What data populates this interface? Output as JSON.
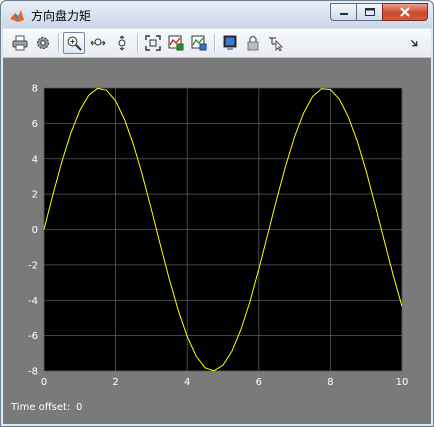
{
  "window": {
    "title": "方向盘力矩"
  },
  "toolbar": {
    "buttons": [
      {
        "name": "print-icon"
      },
      {
        "name": "parameters-gear-icon"
      },
      {
        "name": "zoom-in-icon"
      },
      {
        "name": "zoom-x-icon"
      },
      {
        "name": "zoom-y-icon"
      },
      {
        "name": "autoscale-icon"
      },
      {
        "name": "save-axes-settings-icon"
      },
      {
        "name": "restore-axes-settings-icon"
      },
      {
        "name": "floating-scope-icon"
      },
      {
        "name": "lock-axes-icon"
      },
      {
        "name": "signal-selection-icon"
      },
      {
        "name": "toolbar-overflow-arrow-icon"
      }
    ]
  },
  "footer": {
    "time_offset_label": "Time offset:",
    "time_offset_value": "0"
  },
  "colors": {
    "plot_background": "#000000",
    "scope_background": "#7a7a7a",
    "trace": "#ffff00",
    "grid": "#5a5a5a"
  },
  "chart_data": {
    "type": "line",
    "title": "",
    "xlabel": "",
    "ylabel": "",
    "xlim": [
      0,
      10
    ],
    "ylim": [
      -8,
      8
    ],
    "xticks": [
      0,
      2,
      4,
      6,
      8,
      10
    ],
    "yticks": [
      -8,
      -6,
      -4,
      -2,
      0,
      2,
      4,
      6,
      8
    ],
    "grid": true,
    "series": [
      {
        "color": "#ffff00",
        "x": [
          0,
          0.25,
          0.5,
          0.75,
          1,
          1.25,
          1.5,
          1.75,
          2,
          2.25,
          2.5,
          2.75,
          3,
          3.25,
          3.5,
          3.75,
          4,
          4.25,
          4.5,
          4.75,
          5,
          5.25,
          5.5,
          5.75,
          6,
          6.25,
          6.5,
          6.75,
          7,
          7.25,
          7.5,
          7.75,
          8,
          8.25,
          8.5,
          8.75,
          9,
          9.25,
          9.5,
          9.75,
          10
        ],
        "y": [
          0,
          1.98,
          3.84,
          5.45,
          6.73,
          7.59,
          7.98,
          7.87,
          7.27,
          6.22,
          4.79,
          3.06,
          1.13,
          -0.87,
          -2.81,
          -4.57,
          -6.05,
          -7.16,
          -7.82,
          -7.99,
          -7.67,
          -6.88,
          -5.66,
          -4.1,
          -2.24,
          -0.27,
          1.72,
          3.6,
          5.25,
          6.58,
          7.51,
          7.96,
          7.91,
          7.37,
          6.37,
          5.0,
          3.3,
          1.38,
          -0.6,
          -2.55,
          -4.35
        ]
      }
    ]
  }
}
